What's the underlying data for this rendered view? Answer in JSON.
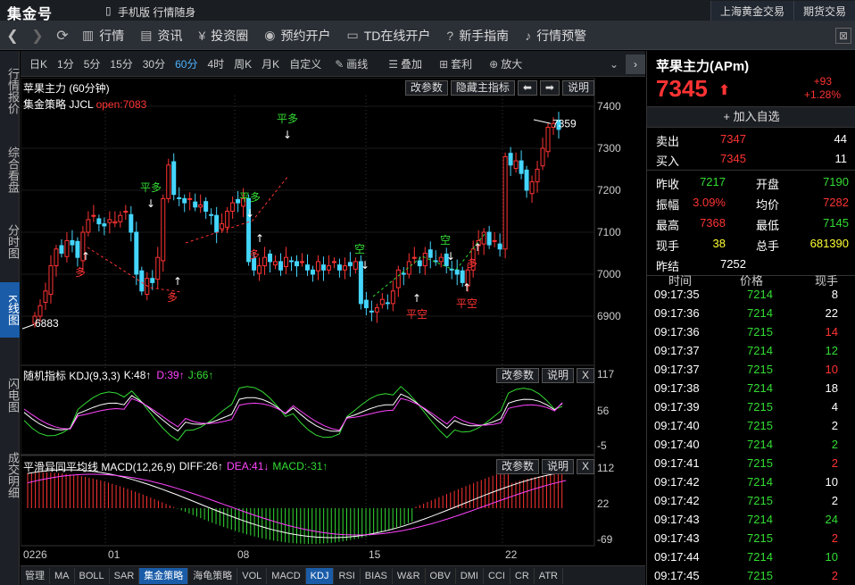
{
  "app": {
    "logo": "集金号",
    "phone_label": "手机版 行情随身",
    "top_links": [
      "上海黄金交易",
      "期货交易"
    ]
  },
  "nav": {
    "items": [
      {
        "icon": "chart-icon",
        "label": "行情"
      },
      {
        "icon": "news-icon",
        "label": "资讯"
      },
      {
        "icon": "yen-icon",
        "label": "投资圈"
      },
      {
        "icon": "pin-icon",
        "label": "预约开户"
      },
      {
        "icon": "card-icon",
        "label": "TD在线开户"
      },
      {
        "icon": "help-icon",
        "label": "新手指南"
      },
      {
        "icon": "bell-icon",
        "label": "行情预警"
      }
    ]
  },
  "sidebar": {
    "items": [
      "行情报价",
      "综合看盘",
      "分时图",
      "K线图",
      "闪电图",
      "成交明细"
    ],
    "active": "K线图"
  },
  "periods": {
    "items": [
      "日K",
      "1分",
      "5分",
      "15分",
      "30分",
      "60分",
      "4时",
      "周K",
      "月K",
      "自定义"
    ],
    "active": "60分",
    "tools": [
      "画线",
      "叠加",
      "套利",
      "放大"
    ]
  },
  "kline": {
    "title": "苹果主力 (60分钟)",
    "strategy_label": "集金策略 JJCL",
    "open_label": "open:7083",
    "buttons": [
      "改参数",
      "隐藏主指标",
      "说明"
    ],
    "y_ticks": [
      "7400",
      "7300",
      "7200",
      "7100",
      "7000",
      "6900"
    ],
    "high_label": "7359",
    "low_label": "6883",
    "signals": [
      "平多",
      "平多",
      "平多",
      "多",
      "多",
      "多",
      "平空",
      "平空",
      "空",
      "空",
      "多",
      "平空"
    ]
  },
  "kdj": {
    "title": "随机指标 KDJ(9,3,3)",
    "k": "K:48↑",
    "d": "D:39↑",
    "j": "J:66↑",
    "buttons": [
      "改参数",
      "说明",
      "X"
    ],
    "y_ticks": [
      "117",
      "56",
      "-5"
    ]
  },
  "macd": {
    "title": "平滑异同平均线 MACD(12,26,9)",
    "diff": "DIFF:26↑",
    "dea": "DEA:41↓",
    "macd": "MACD:-31↑",
    "buttons": [
      "改参数",
      "说明",
      "X"
    ],
    "y_ticks": [
      "112",
      "22",
      "-69"
    ]
  },
  "x_axis": [
    "0226",
    "01",
    "08",
    "15",
    "22"
  ],
  "bottom_tabs": [
    "管理",
    "MA",
    "BOLL",
    "SAR",
    "集金策略",
    "海龟策略",
    "VOL",
    "MACD",
    "KDJ",
    "RSI",
    "BIAS",
    "W&R",
    "OBV",
    "DMI",
    "CCI",
    "CR",
    "ATR"
  ],
  "quote": {
    "name": "苹果主力(APm)",
    "price": "7345",
    "arrow": "⬆",
    "change": "+93",
    "change_pct": "+1.28%",
    "add_watch": "+ 加入自选",
    "ask": {
      "label": "卖出",
      "price": "7347",
      "vol": "44"
    },
    "bid": {
      "label": "买入",
      "price": "7345",
      "vol": "11"
    },
    "stats": [
      [
        "昨收",
        "7217",
        "开盘",
        "7190"
      ],
      [
        "振幅",
        "3.09%",
        "均价",
        "7282"
      ],
      [
        "最高",
        "7368",
        "最低",
        "7145"
      ],
      [
        "现手",
        "38",
        "总手",
        "681390"
      ]
    ],
    "settle_label": "昨结",
    "settle": "7252"
  },
  "trades": {
    "headers": [
      "时间",
      "价格",
      "现手"
    ],
    "rows": [
      [
        "09:17:35",
        "7214",
        "8"
      ],
      [
        "09:17:36",
        "7214",
        "22"
      ],
      [
        "09:17:36",
        "7215",
        "14"
      ],
      [
        "09:17:37",
        "7214",
        "12"
      ],
      [
        "09:17:37",
        "7215",
        "10"
      ],
      [
        "09:17:38",
        "7214",
        "18"
      ],
      [
        "09:17:39",
        "7215",
        "4"
      ],
      [
        "09:17:40",
        "7215",
        "2"
      ],
      [
        "09:17:40",
        "7214",
        "2"
      ],
      [
        "09:17:41",
        "7215",
        "2"
      ],
      [
        "09:17:42",
        "7214",
        "10"
      ],
      [
        "09:17:42",
        "7215",
        "2"
      ],
      [
        "09:17:43",
        "7214",
        "24"
      ],
      [
        "09:17:43",
        "7215",
        "2"
      ],
      [
        "09:17:44",
        "7214",
        "10"
      ],
      [
        "09:17:45",
        "7215",
        "2"
      ]
    ]
  },
  "colors": {
    "up": "#ff3333",
    "down": "#33dd33",
    "candle_down": "#44d6ff",
    "accent": "#1a5ca8"
  }
}
